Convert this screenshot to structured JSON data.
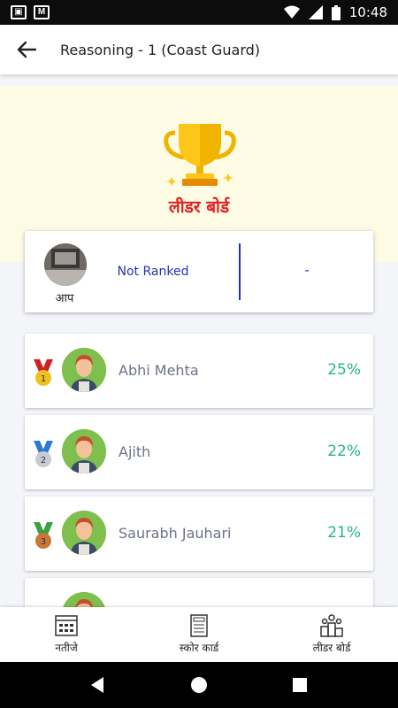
{
  "status_bar": {
    "time": "10:48",
    "left_icons": [
      "notification-icon",
      "gmail-icon"
    ],
    "right_icons": [
      "wifi-icon",
      "signal-icon",
      "battery-icon"
    ]
  },
  "app_bar": {
    "title": "Reasoning - 1 (Coast Guard)",
    "back_icon": "arrow-left-icon"
  },
  "hero": {
    "icon": "trophy-icon",
    "title": "लीडर बोर्ड",
    "background": "#fdfbe3",
    "title_color": "#e02020"
  },
  "my_rank": {
    "label": "आप",
    "rank_text": "Not Ranked",
    "score": "-",
    "accent": "#2530b8"
  },
  "leaderboard": [
    {
      "name": "Abhi Mehta",
      "score": "25%",
      "medal": "gold-medal-icon",
      "rank": "1"
    },
    {
      "name": "Ajith",
      "score": "22%",
      "medal": "silver-medal-icon",
      "rank": "2"
    },
    {
      "name": "Saurabh Jauhari",
      "score": "21%",
      "medal": "bronze-medal-icon",
      "rank": "3"
    },
    {
      "name": "",
      "score": "",
      "medal": "",
      "rank": ""
    }
  ],
  "score_color": "#22b58a",
  "bottom_nav": [
    {
      "label": "नतीजे",
      "icon": "results-grid-icon"
    },
    {
      "label": "स्कोर कार्ड",
      "icon": "scorecard-icon"
    },
    {
      "label": "लीडर बोर्ड",
      "icon": "leaderboard-podium-icon"
    }
  ],
  "system_nav": [
    "back-triangle-icon",
    "home-circle-icon",
    "recents-square-icon"
  ]
}
